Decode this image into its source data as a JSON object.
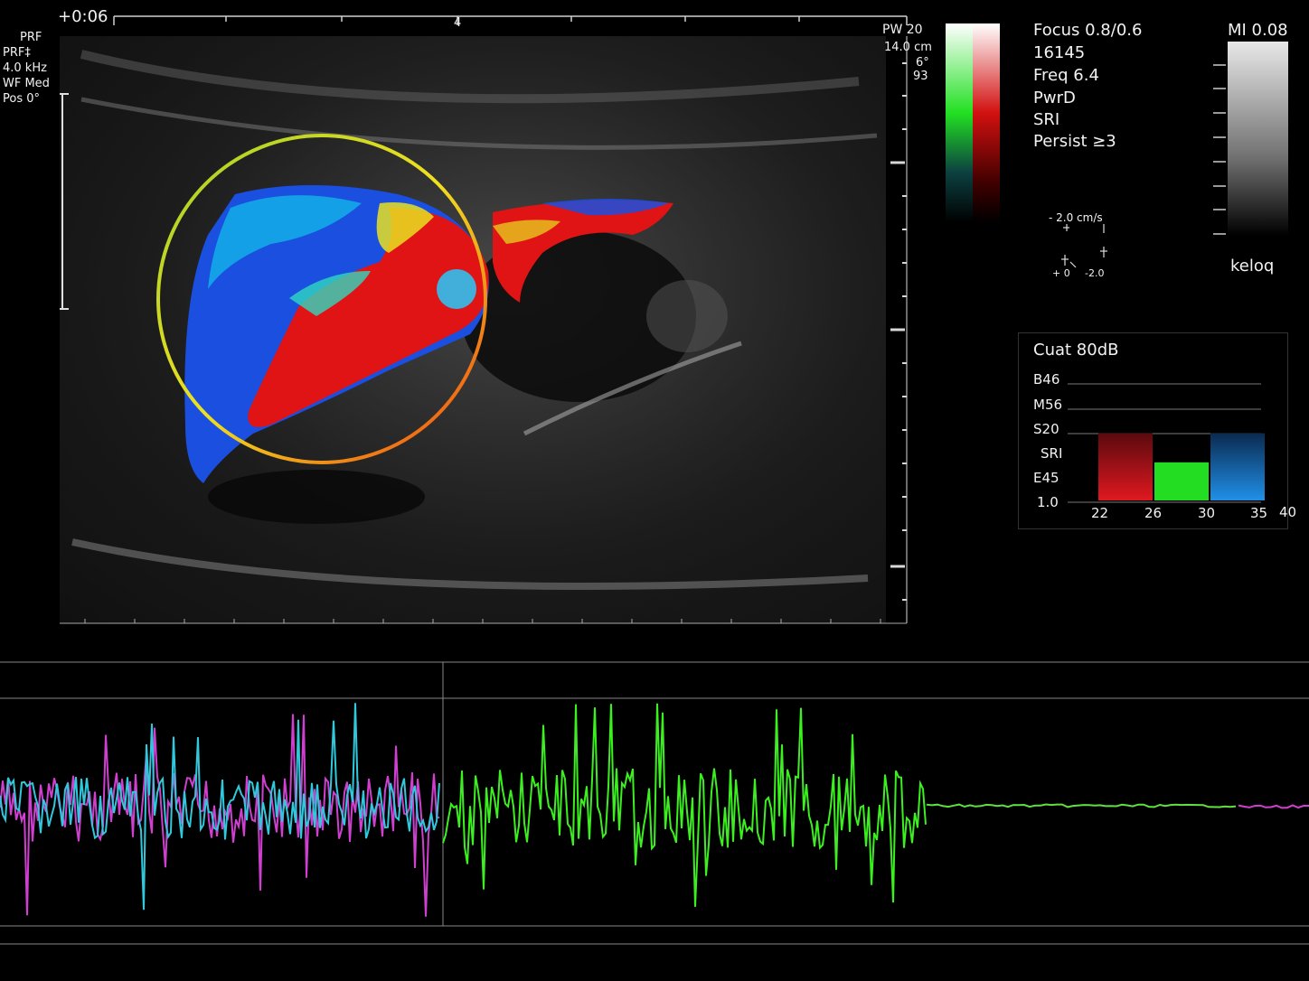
{
  "top_left": {
    "timecode": "+0:06",
    "ruler_mark": "4",
    "mode": "PRF",
    "mode_short": "PRF‡",
    "prf": "4.0 kHz",
    "wall_filter": "WF Med",
    "position": "Pos 0°"
  },
  "top_right": {
    "pw": "PW 20",
    "depth": "14.0 cm",
    "angle": "6°",
    "frame": "93"
  },
  "params": {
    "focus": "Focus  0.8/0.6",
    "id": "16145",
    "freq": "Freq 6.4",
    "mode": "PwrD",
    "sri": "SRI",
    "persist": "Persist ≥3"
  },
  "mi": {
    "label": "MI 0.08",
    "bottom_label": "keloq"
  },
  "velocity": {
    "top": "- 2.0 cm/s",
    "left_bottom": "+ 0",
    "right_bottom": "-2.0"
  },
  "stats": {
    "title": "Cuat 80dB",
    "rows": [
      "B46",
      "M56",
      "S20",
      "SRI",
      "E45",
      "1.0"
    ],
    "x_labels": [
      "22",
      "26",
      "30",
      "35",
      "40"
    ]
  },
  "chart_data": {
    "type": "bar",
    "categories": [
      "22-26",
      "26-30",
      "30-35"
    ],
    "values": [
      3,
      1.7,
      3
    ],
    "colors": [
      "#c0111a",
      "#22dd22",
      "#1a7ad8"
    ],
    "ylim": [
      0,
      5.2
    ]
  },
  "colors": {
    "doppler_red": "#d01010",
    "doppler_blue": "#1040d0",
    "trace_green": "#39ff1f",
    "trace_cyan": "#33ccdd",
    "trace_magenta": "#d43fd4",
    "roi_circle": "#e6d81a"
  }
}
